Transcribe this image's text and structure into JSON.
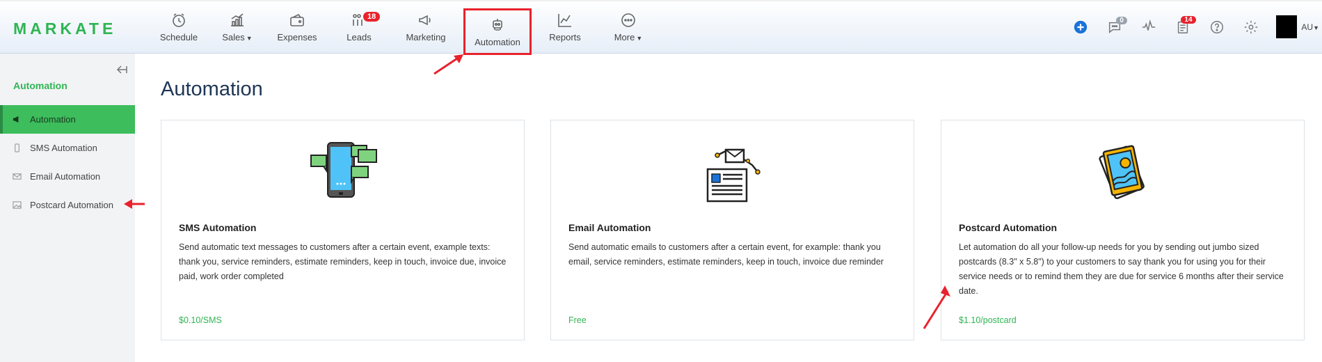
{
  "brand": {
    "logo_text": "MARKATE"
  },
  "nav": {
    "items": [
      {
        "key": "schedule",
        "label": "Schedule"
      },
      {
        "key": "sales",
        "label": "Sales"
      },
      {
        "key": "expenses",
        "label": "Expenses"
      },
      {
        "key": "leads",
        "label": "Leads",
        "badge": "18"
      },
      {
        "key": "marketing",
        "label": "Marketing"
      },
      {
        "key": "automation",
        "label": "Automation"
      },
      {
        "key": "reports",
        "label": "Reports"
      },
      {
        "key": "more",
        "label": "More"
      }
    ],
    "selected": "automation"
  },
  "header_right": {
    "messages_badge": "0",
    "tasks_badge": "14",
    "user_label": "AU"
  },
  "sidebar": {
    "title": "Automation",
    "items": [
      {
        "label": "Automation",
        "icon": "megaphone-icon",
        "active": true
      },
      {
        "label": "SMS Automation",
        "icon": "phone-icon"
      },
      {
        "label": "Email Automation",
        "icon": "envelope-icon"
      },
      {
        "label": "Postcard Automation",
        "icon": "image-icon"
      }
    ]
  },
  "main": {
    "title": "Automation",
    "cards": [
      {
        "title": "SMS Automation",
        "description": "Send automatic text messages to customers after a certain event, example texts: thank you, service reminders, estimate reminders, keep in touch, invoice due, invoice paid, work order completed",
        "price": "$0.10/SMS",
        "icon": "smartphone-chat-icon"
      },
      {
        "title": "Email Automation",
        "description": "Send automatic emails to customers after a certain event, for example: thank you email, service reminders, estimate reminders, keep in touch, invoice due reminder",
        "price": "Free",
        "icon": "email-newsletter-icon"
      },
      {
        "title": "Postcard Automation",
        "description": "Let automation do all your follow-up needs for you by sending out jumbo sized postcards (8.3\" x 5.8\") to your customers to say thank you for using you for their service needs or to remind them they are due for service 6 months after their service date.",
        "price": "$1.10/postcard",
        "icon": "postcard-stack-icon"
      }
    ]
  },
  "colors": {
    "brand_green": "#2fb553",
    "active_green": "#3dbd5c",
    "badge_red": "#e8222d",
    "annotation_red": "#e8222d",
    "title_navy": "#1e3556"
  }
}
